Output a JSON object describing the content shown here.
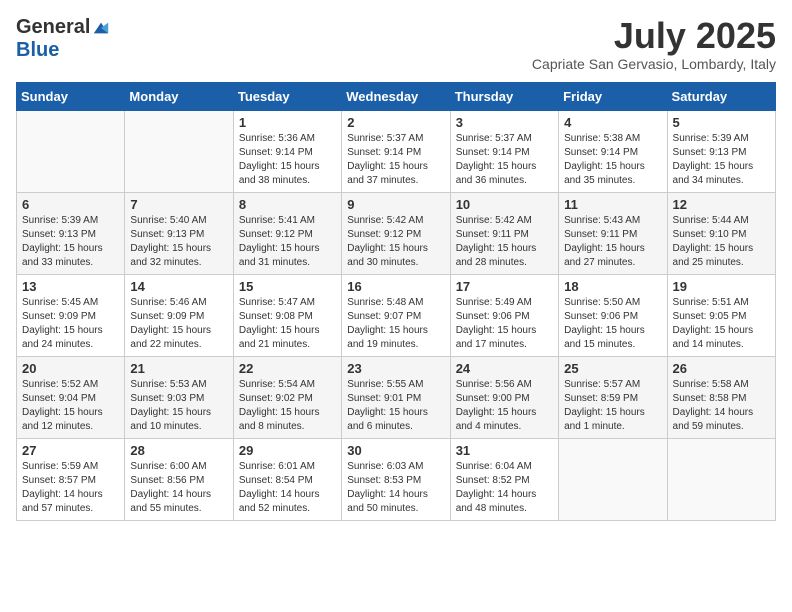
{
  "logo": {
    "general": "General",
    "blue": "Blue"
  },
  "title": "July 2025",
  "subtitle": "Capriate San Gervasio, Lombardy, Italy",
  "headers": [
    "Sunday",
    "Monday",
    "Tuesday",
    "Wednesday",
    "Thursday",
    "Friday",
    "Saturday"
  ],
  "rows": [
    [
      {
        "day": "",
        "info": ""
      },
      {
        "day": "",
        "info": ""
      },
      {
        "day": "1",
        "info": "Sunrise: 5:36 AM\nSunset: 9:14 PM\nDaylight: 15 hours\nand 38 minutes."
      },
      {
        "day": "2",
        "info": "Sunrise: 5:37 AM\nSunset: 9:14 PM\nDaylight: 15 hours\nand 37 minutes."
      },
      {
        "day": "3",
        "info": "Sunrise: 5:37 AM\nSunset: 9:14 PM\nDaylight: 15 hours\nand 36 minutes."
      },
      {
        "day": "4",
        "info": "Sunrise: 5:38 AM\nSunset: 9:14 PM\nDaylight: 15 hours\nand 35 minutes."
      },
      {
        "day": "5",
        "info": "Sunrise: 5:39 AM\nSunset: 9:13 PM\nDaylight: 15 hours\nand 34 minutes."
      }
    ],
    [
      {
        "day": "6",
        "info": "Sunrise: 5:39 AM\nSunset: 9:13 PM\nDaylight: 15 hours\nand 33 minutes."
      },
      {
        "day": "7",
        "info": "Sunrise: 5:40 AM\nSunset: 9:13 PM\nDaylight: 15 hours\nand 32 minutes."
      },
      {
        "day": "8",
        "info": "Sunrise: 5:41 AM\nSunset: 9:12 PM\nDaylight: 15 hours\nand 31 minutes."
      },
      {
        "day": "9",
        "info": "Sunrise: 5:42 AM\nSunset: 9:12 PM\nDaylight: 15 hours\nand 30 minutes."
      },
      {
        "day": "10",
        "info": "Sunrise: 5:42 AM\nSunset: 9:11 PM\nDaylight: 15 hours\nand 28 minutes."
      },
      {
        "day": "11",
        "info": "Sunrise: 5:43 AM\nSunset: 9:11 PM\nDaylight: 15 hours\nand 27 minutes."
      },
      {
        "day": "12",
        "info": "Sunrise: 5:44 AM\nSunset: 9:10 PM\nDaylight: 15 hours\nand 25 minutes."
      }
    ],
    [
      {
        "day": "13",
        "info": "Sunrise: 5:45 AM\nSunset: 9:09 PM\nDaylight: 15 hours\nand 24 minutes."
      },
      {
        "day": "14",
        "info": "Sunrise: 5:46 AM\nSunset: 9:09 PM\nDaylight: 15 hours\nand 22 minutes."
      },
      {
        "day": "15",
        "info": "Sunrise: 5:47 AM\nSunset: 9:08 PM\nDaylight: 15 hours\nand 21 minutes."
      },
      {
        "day": "16",
        "info": "Sunrise: 5:48 AM\nSunset: 9:07 PM\nDaylight: 15 hours\nand 19 minutes."
      },
      {
        "day": "17",
        "info": "Sunrise: 5:49 AM\nSunset: 9:06 PM\nDaylight: 15 hours\nand 17 minutes."
      },
      {
        "day": "18",
        "info": "Sunrise: 5:50 AM\nSunset: 9:06 PM\nDaylight: 15 hours\nand 15 minutes."
      },
      {
        "day": "19",
        "info": "Sunrise: 5:51 AM\nSunset: 9:05 PM\nDaylight: 15 hours\nand 14 minutes."
      }
    ],
    [
      {
        "day": "20",
        "info": "Sunrise: 5:52 AM\nSunset: 9:04 PM\nDaylight: 15 hours\nand 12 minutes."
      },
      {
        "day": "21",
        "info": "Sunrise: 5:53 AM\nSunset: 9:03 PM\nDaylight: 15 hours\nand 10 minutes."
      },
      {
        "day": "22",
        "info": "Sunrise: 5:54 AM\nSunset: 9:02 PM\nDaylight: 15 hours\nand 8 minutes."
      },
      {
        "day": "23",
        "info": "Sunrise: 5:55 AM\nSunset: 9:01 PM\nDaylight: 15 hours\nand 6 minutes."
      },
      {
        "day": "24",
        "info": "Sunrise: 5:56 AM\nSunset: 9:00 PM\nDaylight: 15 hours\nand 4 minutes."
      },
      {
        "day": "25",
        "info": "Sunrise: 5:57 AM\nSunset: 8:59 PM\nDaylight: 15 hours\nand 1 minute."
      },
      {
        "day": "26",
        "info": "Sunrise: 5:58 AM\nSunset: 8:58 PM\nDaylight: 14 hours\nand 59 minutes."
      }
    ],
    [
      {
        "day": "27",
        "info": "Sunrise: 5:59 AM\nSunset: 8:57 PM\nDaylight: 14 hours\nand 57 minutes."
      },
      {
        "day": "28",
        "info": "Sunrise: 6:00 AM\nSunset: 8:56 PM\nDaylight: 14 hours\nand 55 minutes."
      },
      {
        "day": "29",
        "info": "Sunrise: 6:01 AM\nSunset: 8:54 PM\nDaylight: 14 hours\nand 52 minutes."
      },
      {
        "day": "30",
        "info": "Sunrise: 6:03 AM\nSunset: 8:53 PM\nDaylight: 14 hours\nand 50 minutes."
      },
      {
        "day": "31",
        "info": "Sunrise: 6:04 AM\nSunset: 8:52 PM\nDaylight: 14 hours\nand 48 minutes."
      },
      {
        "day": "",
        "info": ""
      },
      {
        "day": "",
        "info": ""
      }
    ]
  ]
}
